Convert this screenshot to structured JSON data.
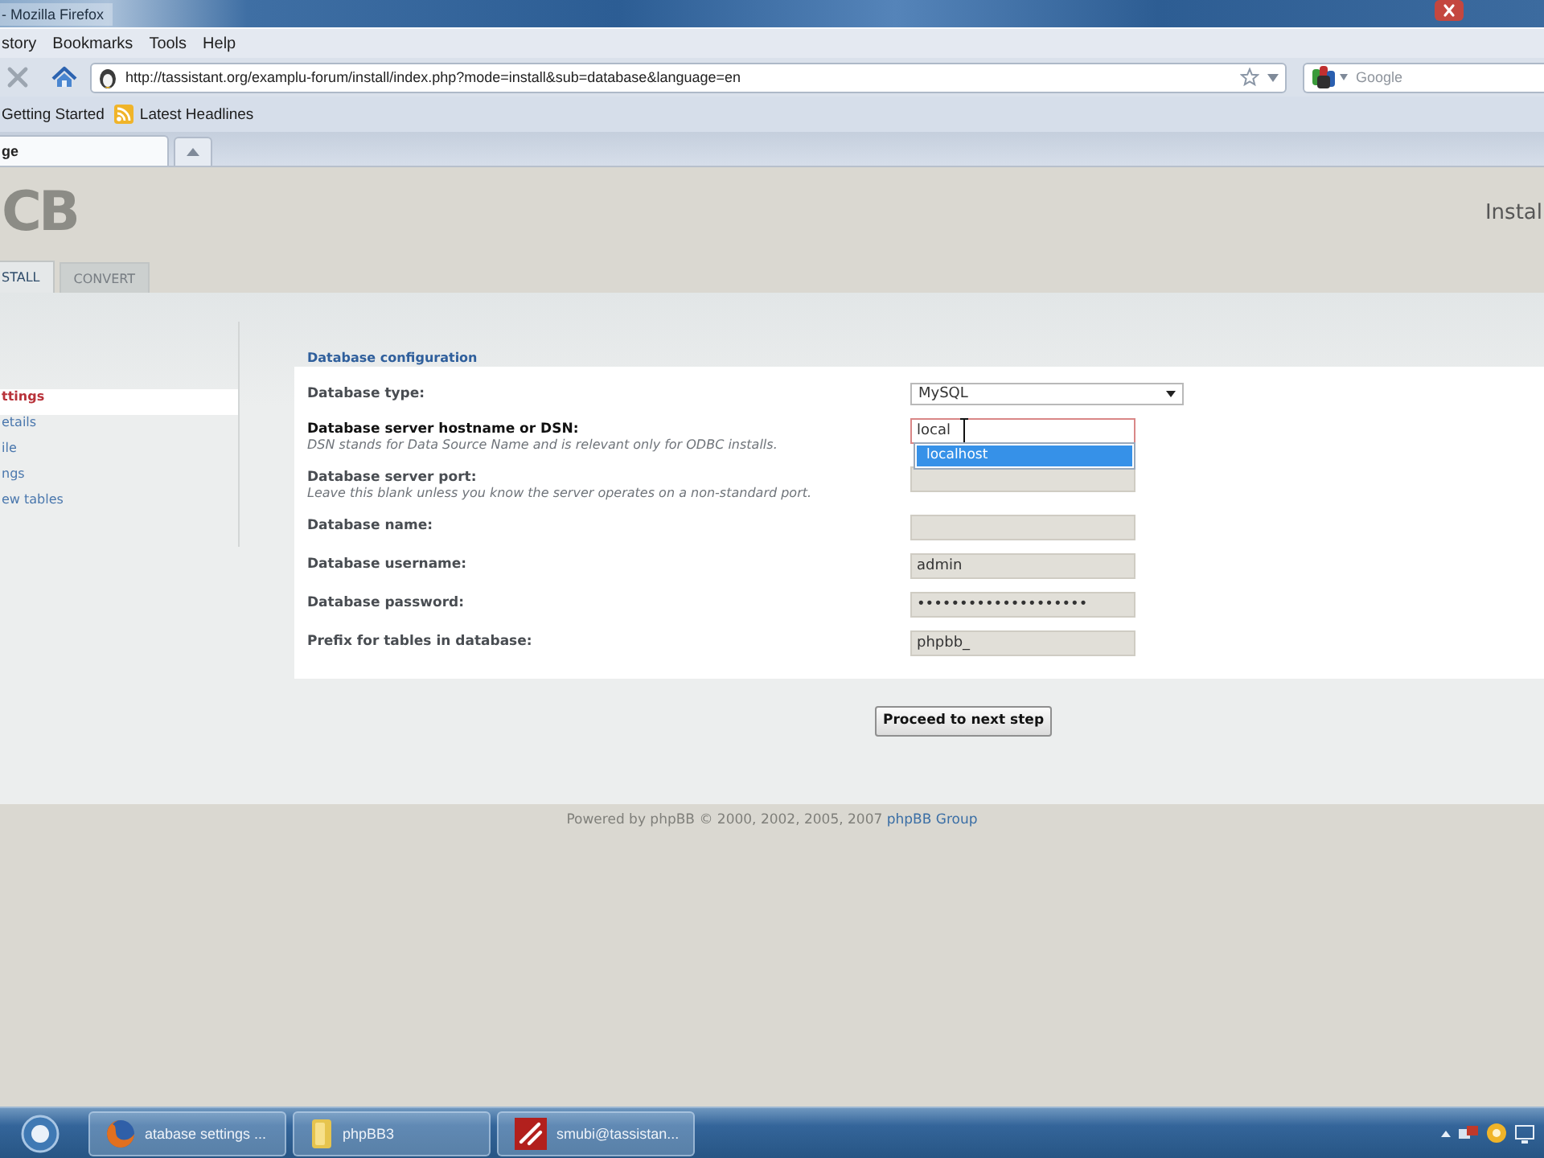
{
  "window": {
    "title": "- Mozilla Firefox"
  },
  "menu": [
    {
      "label": "story"
    },
    {
      "label": "Bookmarks"
    },
    {
      "label": "Tools"
    },
    {
      "label": "Help"
    }
  ],
  "navigation": {
    "url": "http://tassistant.org/examplu-forum/install/index.php?mode=install&sub=database&language=en",
    "search": {
      "placeholder": "Google"
    }
  },
  "bookmarks": [
    {
      "label": "Getting Started",
      "kind": "plain"
    },
    {
      "label": "Latest Headlines",
      "kind": "feed"
    }
  ],
  "tabs": [
    {
      "label": "ge",
      "selected": true
    }
  ],
  "page": {
    "logo": "CB",
    "title": "Instal",
    "tabs": [
      {
        "label": "STALL",
        "selected": true
      },
      {
        "label": "CONVERT",
        "selected": false
      }
    ],
    "sidebar": [
      {
        "label": "ttings",
        "selected": true
      },
      {
        "label": "etails",
        "selected": false
      },
      {
        "label": "ile",
        "selected": false
      },
      {
        "label": "ngs",
        "selected": false
      },
      {
        "label": "ew tables",
        "selected": false
      }
    ],
    "form": {
      "title": "Database configuration",
      "fields": [
        {
          "label": "Database type:",
          "kind": "select",
          "value": "MySQL",
          "focused": false
        },
        {
          "label": "Database server hostname or DSN:",
          "explain": "DSN stands for Data Source Name and is relevant only for ODBC installs.",
          "kind": "text",
          "value": "local",
          "focused": true,
          "suggestions": [
            {
              "label": "localhost",
              "selected": true
            }
          ]
        },
        {
          "label": "Database server port:",
          "explain": "Leave this blank unless you know the server operates on a non-standard port.",
          "kind": "text",
          "focused": false
        },
        {
          "label": "Database name:",
          "kind": "text",
          "focused": false
        },
        {
          "label": "Database username:",
          "kind": "text",
          "value": "admin",
          "focused": false
        },
        {
          "label": "Database password:",
          "kind": "password",
          "value": "••••••••••••••••••••",
          "focused": false
        },
        {
          "label": "Prefix for tables in database:",
          "kind": "text",
          "value": "phpbb_",
          "focused": false
        }
      ]
    },
    "submit": "Proceed to next step",
    "footer": {
      "text": "Powered by phpBB © 2000, 2002, 2005, 2007 ",
      "link": "phpBB Group"
    }
  },
  "taskbar": [
    {
      "label": "atabase settings ...",
      "kind": "browser"
    },
    {
      "label": "phpBB3",
      "kind": "folder"
    },
    {
      "label": "smubi@tassistan...",
      "kind": "ftp"
    }
  ]
}
